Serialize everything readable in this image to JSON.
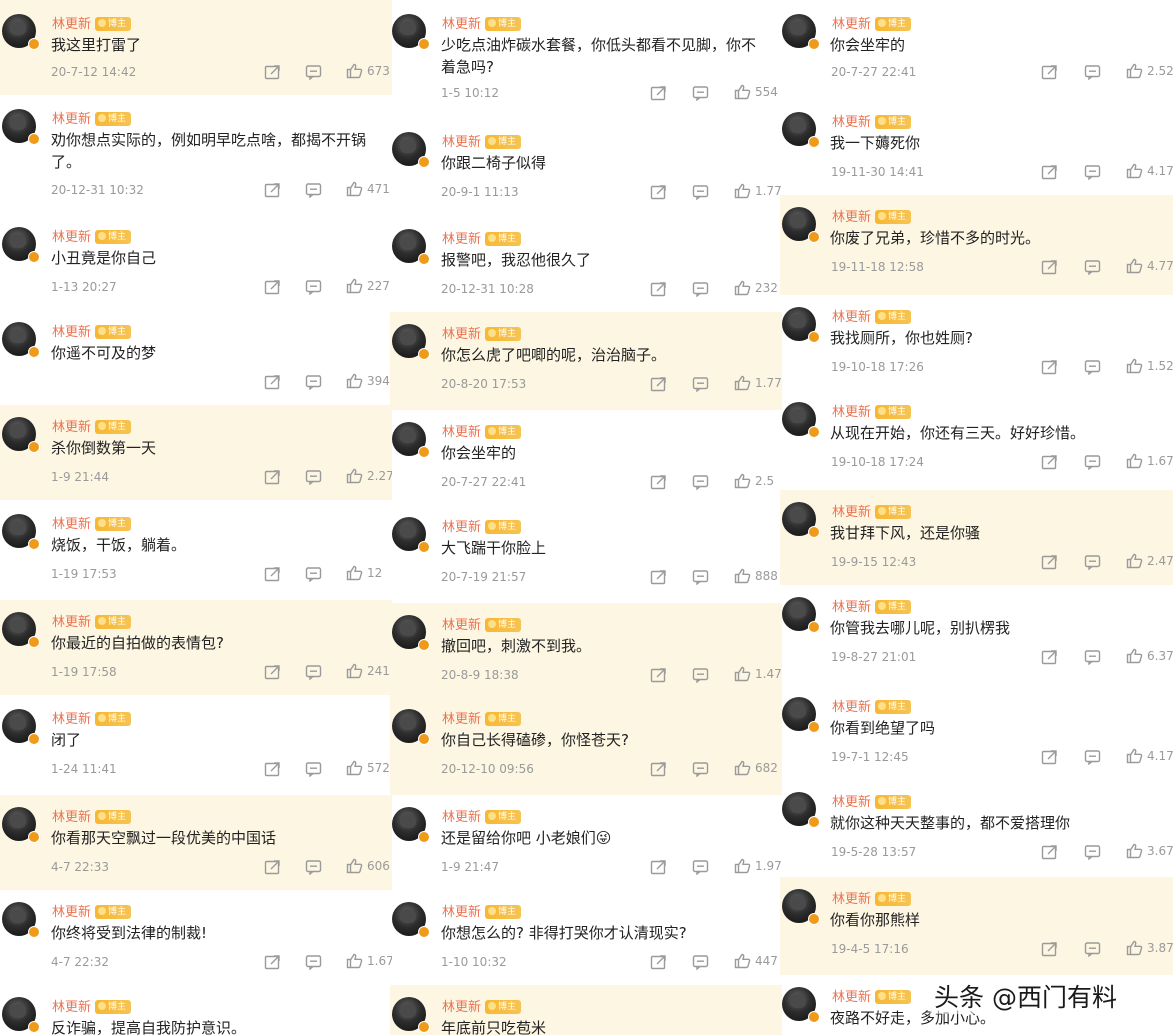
{
  "user": {
    "name": "林更新",
    "badge": "博主"
  },
  "columns": [
    {
      "comments": [
        {
          "text": "我这里打雷了",
          "time": "20-7-12 14:42",
          "likes": "673",
          "hl": true
        },
        {
          "text": "劝你想点实际的，例如明早吃点啥，都揭不开锅",
          "text2": "了。",
          "time": "20-12-31 10:32",
          "likes": "471",
          "hl": false
        },
        {
          "text": "小丑竟是你自己",
          "time": "1-13 20:27",
          "likes": "227",
          "hl": false
        },
        {
          "text": "你遥不可及的梦",
          "time": "",
          "likes": "394",
          "hl": false
        },
        {
          "text": "杀你倒数第一天",
          "time": "1-9 21:44",
          "likes": "2.27",
          "hl": true
        },
        {
          "text": "烧饭，干饭，躺着。",
          "time": "1-19 17:53",
          "likes": "12",
          "hl": false
        },
        {
          "text": "你最近的自拍做的表情包?",
          "time": "1-19 17:58",
          "likes": "241",
          "hl": true
        },
        {
          "text": "闭了",
          "time": "1-24 11:41",
          "likes": "572",
          "hl": false
        },
        {
          "text": "你看那天空飘过一段优美的中国话",
          "time": "4-7 22:33",
          "likes": "606",
          "hl": true
        },
        {
          "text": "你终将受到法律的制裁!",
          "time": "4-7 22:32",
          "likes": "1.67",
          "hl": false
        },
        {
          "text": "反诈骗，提高自我防护意识。",
          "time": "",
          "likes": "",
          "hl": false
        }
      ]
    },
    {
      "comments": [
        {
          "text": "少吃点油炸碳水套餐，你低头都看不见脚，你不",
          "text2": "着急吗?",
          "time": "1-5 10:12",
          "likes": "554",
          "hl": false
        },
        {
          "text": "你跟二椅子似得",
          "time": "20-9-1 11:13",
          "likes": "1.77",
          "hl": false
        },
        {
          "text": "报警吧，我忍他很久了",
          "time": "20-12-31 10:28",
          "likes": "232",
          "hl": false
        },
        {
          "text": "你怎么虎了吧唧的呢，治治脑子。",
          "time": "20-8-20 17:53",
          "likes": "1.77",
          "hl": true
        },
        {
          "text": "你会坐牢的",
          "time": "20-7-27 22:41",
          "likes": "2.5",
          "hl": false
        },
        {
          "text": "大飞踹干你脸上",
          "time": "20-7-19 21:57",
          "likes": "888",
          "hl": false
        },
        {
          "text": "撤回吧，刺激不到我。",
          "time": "20-8-9 18:38",
          "likes": "1.47",
          "hl": true
        },
        {
          "text": "你自己长得磕碜，你怪苍天?",
          "time": "20-12-10 09:56",
          "likes": "682",
          "hl": true
        },
        {
          "text": "还是留给你吧 小老娘们😜",
          "time": "1-9 21:47",
          "likes": "1.97",
          "hl": false
        },
        {
          "text": "你想怎么的? 非得打哭你才认清现实?",
          "time": "1-10 10:32",
          "likes": "447",
          "hl": false
        },
        {
          "text": "年底前只吃苞米",
          "time": "",
          "likes": "",
          "hl": true
        }
      ]
    },
    {
      "comments": [
        {
          "text": "你会坐牢的",
          "time": "20-7-27 22:41",
          "likes": "2.52",
          "hl": false
        },
        {
          "text": "我一下薅死你",
          "time": "19-11-30 14:41",
          "likes": "4.17",
          "hl": false
        },
        {
          "text": "你废了兄弟，珍惜不多的时光。",
          "time": "19-11-18 12:58",
          "likes": "4.77",
          "hl": true
        },
        {
          "text": "我找厕所，你也姓厕?",
          "time": "19-10-18 17:26",
          "likes": "1.52",
          "hl": false
        },
        {
          "text": "从现在开始，你还有三天。好好珍惜。",
          "time": "19-10-18 17:24",
          "likes": "1.67",
          "hl": false
        },
        {
          "text": "我甘拜下风，还是你骚",
          "time": "19-9-15 12:43",
          "likes": "2.47",
          "hl": true
        },
        {
          "text": "你管我去哪儿呢，别扒楞我",
          "time": "19-8-27 21:01",
          "likes": "6.37",
          "hl": false
        },
        {
          "text": "你看到绝望了吗",
          "time": "19-7-1 12:45",
          "likes": "4.17",
          "hl": false
        },
        {
          "text": "就你这种天天整事的，都不爱搭理你",
          "time": "19-5-28 13:57",
          "likes": "3.67",
          "hl": false
        },
        {
          "text": "你看你那熊样",
          "time": "19-4-5 17:16",
          "likes": "3.87",
          "hl": true
        },
        {
          "text": "夜路不好走，多加小心。",
          "time": "",
          "likes": "",
          "hl": false
        }
      ]
    }
  ],
  "watermark": "头条 @西门有料",
  "colors": {
    "username": "#eb7350",
    "highlight_bg": "#fdf6e3",
    "meta": "#9a9a9a",
    "badge": "#f7b733"
  },
  "icons": {
    "share": "share-icon",
    "comment": "comment-icon",
    "like": "thumbs-up-icon",
    "verified": "verified-badge-icon"
  }
}
